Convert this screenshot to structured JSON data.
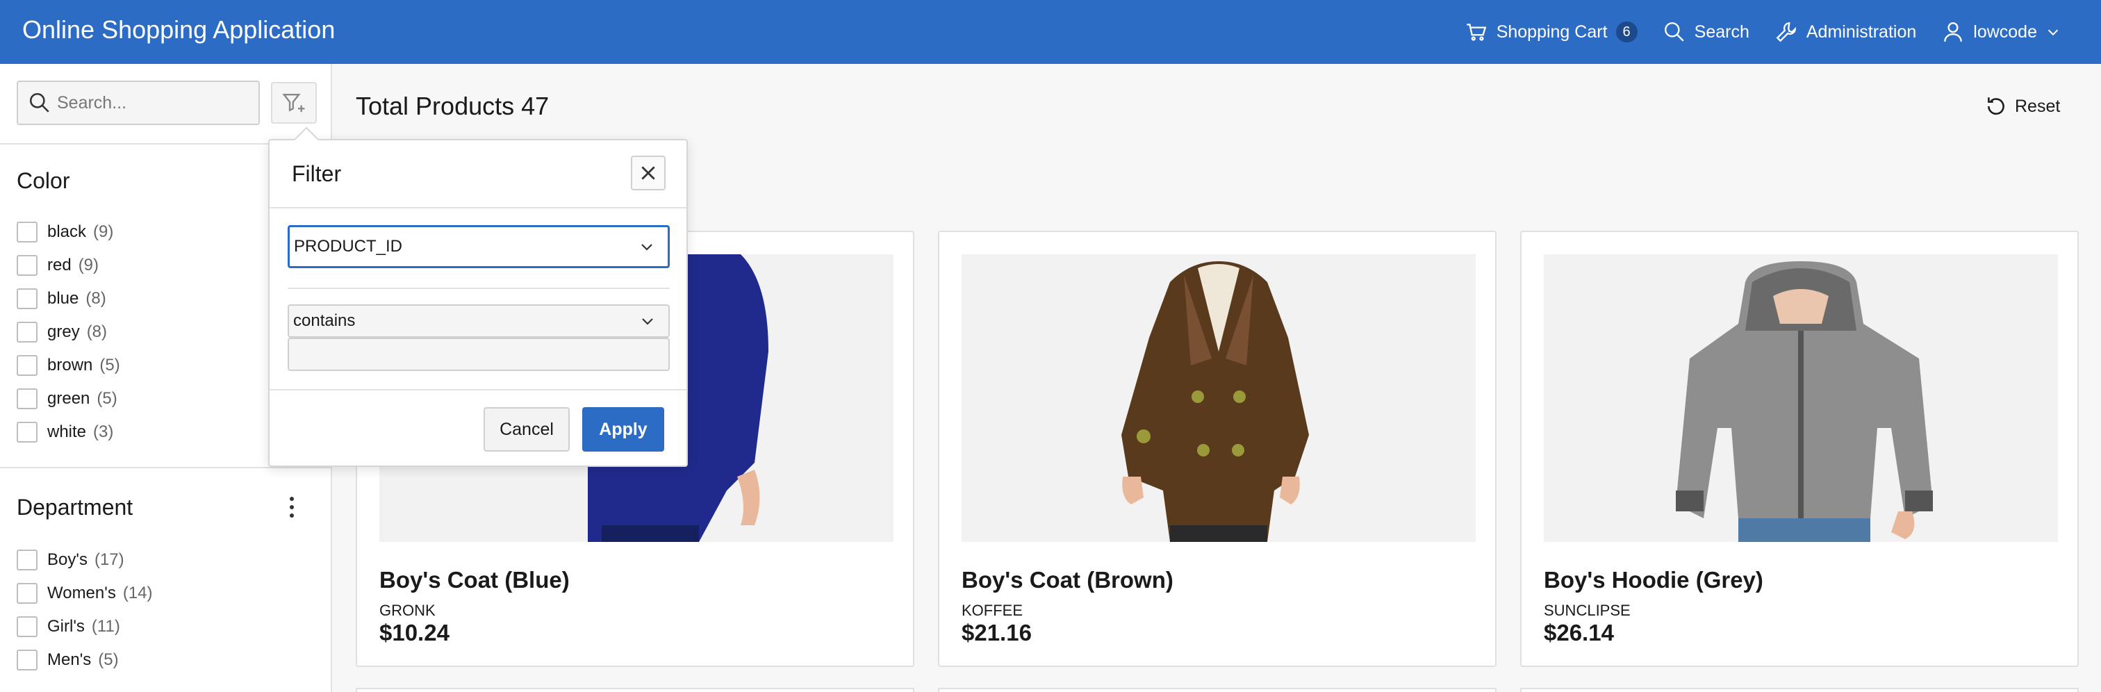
{
  "header": {
    "title": "Online Shopping Application",
    "cart_label": "Shopping Cart",
    "cart_count": "6",
    "search_label": "Search",
    "admin_label": "Administration",
    "user_label": "lowcode"
  },
  "sidebar": {
    "search_placeholder": "Search...",
    "facets": [
      {
        "title": "Color",
        "options": [
          {
            "label": "black",
            "count": "(9)"
          },
          {
            "label": "red",
            "count": "(9)"
          },
          {
            "label": "blue",
            "count": "(8)"
          },
          {
            "label": "grey",
            "count": "(8)"
          },
          {
            "label": "brown",
            "count": "(5)"
          },
          {
            "label": "green",
            "count": "(5)"
          },
          {
            "label": "white",
            "count": "(3)"
          }
        ]
      },
      {
        "title": "Department",
        "options": [
          {
            "label": "Boy's",
            "count": "(17)"
          },
          {
            "label": "Women's",
            "count": "(14)"
          },
          {
            "label": "Girl's",
            "count": "(11)"
          },
          {
            "label": "Men's",
            "count": "(5)"
          }
        ]
      }
    ]
  },
  "main": {
    "title": "Total Products 47",
    "reset_label": "Reset",
    "products": [
      {
        "name": "Boy's Coat (Blue)",
        "brand": "GRONK",
        "price": "$10.24",
        "color": "#1f2a8c"
      },
      {
        "name": "Boy's Coat (Brown)",
        "brand": "KOFFEE",
        "price": "$21.16",
        "color": "#5a3a1c"
      },
      {
        "name": "Boy's Hoodie (Grey)",
        "brand": "SUNCLIPSE",
        "price": "$26.14",
        "color": "#8e8e8e"
      }
    ]
  },
  "filter_popup": {
    "title": "Filter",
    "column_value": "PRODUCT_ID",
    "operator_value": "contains",
    "filter_value": "",
    "cancel_label": "Cancel",
    "apply_label": "Apply"
  },
  "colors": {
    "brand": "#2d6cc5",
    "background": "#f7f7f7"
  }
}
